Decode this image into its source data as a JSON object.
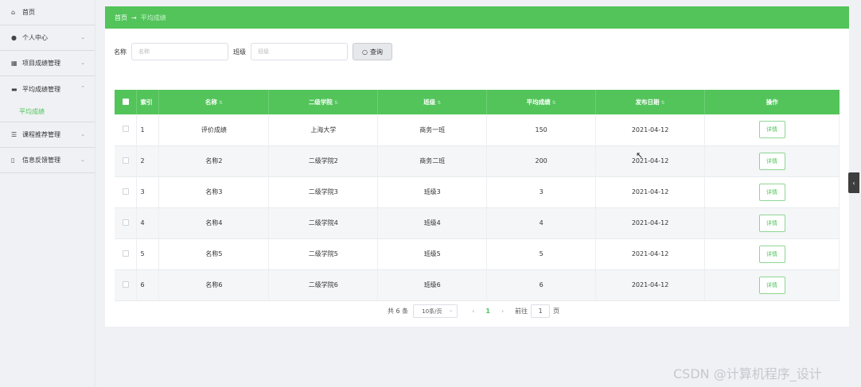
{
  "sidebar": {
    "items": [
      {
        "icon": "home-icon",
        "glyph": "⌂",
        "label": "首页",
        "chev": ""
      },
      {
        "icon": "user-icon",
        "glyph": "●",
        "label": "个人中心",
        "chev": "⌄"
      },
      {
        "icon": "grid-icon",
        "glyph": "▦",
        "label": "项目成绩管理",
        "chev": "⌄"
      },
      {
        "icon": "monitor-icon",
        "glyph": "▬",
        "label": "平均成绩管理",
        "chev": "⌃"
      },
      {
        "icon": "list-icon",
        "glyph": "☰",
        "label": "课程推荐管理",
        "chev": "⌄"
      },
      {
        "icon": "phone-icon",
        "glyph": "▯",
        "label": "信息反馈管理",
        "chev": "⌄"
      }
    ],
    "sub_item": "平均成绩"
  },
  "breadcrumb": {
    "home": "首页",
    "sep": "→",
    "current": "平均成绩"
  },
  "search": {
    "name_label": "名称",
    "name_placeholder": "名称",
    "class_label": "班级",
    "class_placeholder": "班级",
    "query_button": "查询"
  },
  "table": {
    "headers": [
      "索引",
      "名称",
      "二级学院",
      "班级",
      "平均成绩",
      "发布日期",
      "操作"
    ],
    "rows": [
      {
        "idx": "1",
        "name": "评价成绩",
        "college": "上海大学",
        "class": "商务一班",
        "avg": "150",
        "date": "2021-04-12",
        "action": "详情"
      },
      {
        "idx": "2",
        "name": "名称2",
        "college": "二级学院2",
        "class": "商务二班",
        "avg": "200",
        "date": "2021-04-12",
        "action": "详情"
      },
      {
        "idx": "3",
        "name": "名称3",
        "college": "二级学院3",
        "class": "班级3",
        "avg": "3",
        "date": "2021-04-12",
        "action": "详情"
      },
      {
        "idx": "4",
        "name": "名称4",
        "college": "二级学院4",
        "class": "班级4",
        "avg": "4",
        "date": "2021-04-12",
        "action": "详情"
      },
      {
        "idx": "5",
        "name": "名称5",
        "college": "二级学院5",
        "class": "班级5",
        "avg": "5",
        "date": "2021-04-12",
        "action": "详情"
      },
      {
        "idx": "6",
        "name": "名称6",
        "college": "二级学院6",
        "class": "班级6",
        "avg": "6",
        "date": "2021-04-12",
        "action": "详情"
      }
    ]
  },
  "pager": {
    "total": "共 6 条",
    "page_size": "10条/页",
    "prev": "‹",
    "current": "1",
    "next": "›",
    "goto_label": "前往",
    "goto_value": "1",
    "goto_suffix": "页"
  },
  "watermark": "CSDN @计算机程序_设计",
  "toggle": "‹",
  "colors": {
    "accent": "#52c45a",
    "background": "#f0f1f5"
  }
}
